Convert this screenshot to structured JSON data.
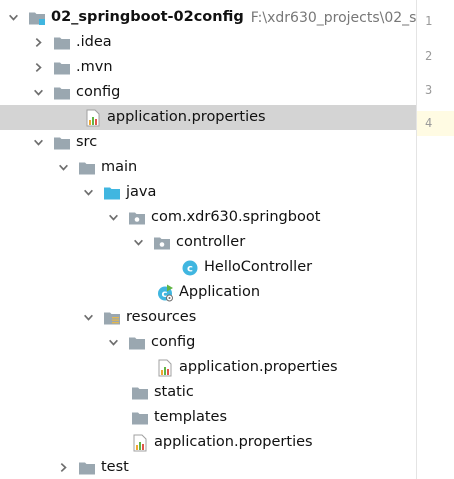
{
  "project": {
    "name": "02_springboot-02config",
    "path": "F:\\xdr630_projects\\02_s"
  },
  "tree": {
    "idea": ".idea",
    "mvn": ".mvn",
    "config": "config",
    "config_props": "application.properties",
    "src": "src",
    "main": "main",
    "java": "java",
    "package": "com.xdr630.springboot",
    "controller": "controller",
    "hello_controller": "HelloController",
    "application": "Application",
    "resources": "resources",
    "res_config": "config",
    "res_config_props": "application.properties",
    "static": "static",
    "templates": "templates",
    "res_props": "application.properties",
    "test": "test"
  },
  "editor": {
    "line_numbers": [
      "1",
      "2",
      "3",
      "4"
    ],
    "current_line": "4"
  }
}
